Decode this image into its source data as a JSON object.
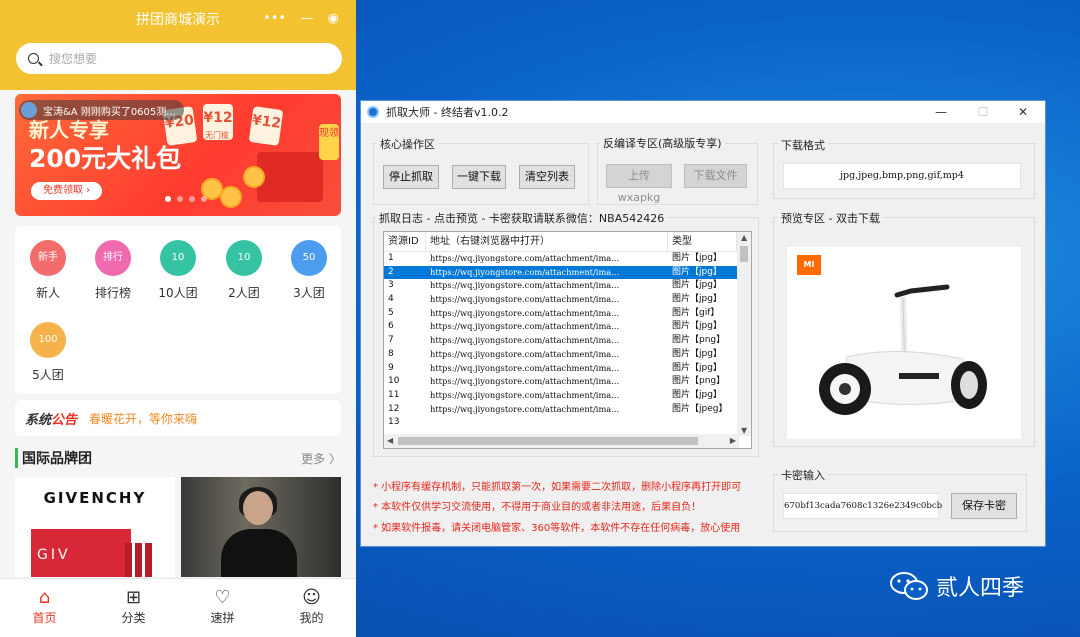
{
  "phone": {
    "title": "拼团商城演示",
    "capsule": [
      "•••",
      "—",
      "◉"
    ],
    "search_placeholder": "搜您想要",
    "banner": {
      "ticker": "宝涛&A 刚刚购买了0605测...",
      "headline1": "新人专享",
      "headline2": "200元大礼包",
      "cta": "免费领取 ›",
      "coupons": [
        "¥20",
        "¥12",
        "¥12"
      ],
      "coupon_sub": "无门槛",
      "side_tag": "现领"
    },
    "categories": [
      {
        "label": "新人",
        "icon_text": "新手",
        "color": "#f36c6c"
      },
      {
        "label": "排行榜",
        "icon_text": "排行",
        "color": "#f06ab0"
      },
      {
        "label": "10人团",
        "icon_text": "10",
        "color": "#36c3a3"
      },
      {
        "label": "2人团",
        "icon_text": "10",
        "color": "#36c3a3"
      },
      {
        "label": "3人团",
        "icon_text": "50",
        "color": "#4c9cf0"
      },
      {
        "label": "5人团",
        "icon_text": "100",
        "color": "#f5b14a"
      }
    ],
    "notice": {
      "prefix": "系统",
      "highlight": "公告",
      "text": "春暖花开，等你来嗨"
    },
    "brands": {
      "title": "国际品牌团",
      "more": "更多 〉",
      "brand1_logo": "GIVENCHY",
      "brand1_box": "GIV"
    },
    "tabs": [
      {
        "label": "首页",
        "icon": "home-icon",
        "glyph": "⌂",
        "active": true
      },
      {
        "label": "分类",
        "icon": "grid-icon",
        "glyph": "⊞",
        "active": false
      },
      {
        "label": "速拼",
        "icon": "heart-icon",
        "glyph": "♡",
        "active": false
      },
      {
        "label": "我的",
        "icon": "smile-icon",
        "glyph": "☺",
        "active": false
      }
    ]
  },
  "app": {
    "title": "抓取大师 - 终结者v1.0.2",
    "window_buttons": [
      "—",
      "☐",
      "✕"
    ],
    "core": {
      "label": "核心操作区",
      "buttons": [
        "停止抓取",
        "一键下载",
        "清空列表"
      ]
    },
    "decompile": {
      "label": "反编译专区(高级版专享)",
      "buttons": [
        "上传wxapkg",
        "下载文件"
      ]
    },
    "format": {
      "label": "下载格式",
      "value": "jpg,jpeg,bmp,png,gif,mp4"
    },
    "log": {
      "label": "抓取日志 - 点击预览 - 卡密获取请联系微信：NBA542426",
      "columns": [
        "资源ID",
        "地址（右键浏览器中打开）",
        "类型"
      ],
      "rows": [
        {
          "id": "1",
          "url": "https://wq.jiyongstore.com/attachment/ima...",
          "type": "图片【jpg】"
        },
        {
          "id": "2",
          "url": "https://wq.jiyongstore.com/attachment/ima...",
          "type": "图片【jpg】"
        },
        {
          "id": "3",
          "url": "https://wq.jiyongstore.com/attachment/ima...",
          "type": "图片【jpg】"
        },
        {
          "id": "4",
          "url": "https://wq.jiyongstore.com/attachment/ima...",
          "type": "图片【jpg】"
        },
        {
          "id": "5",
          "url": "https://wq.jiyongstore.com/attachment/ima...",
          "type": "图片【gif】"
        },
        {
          "id": "6",
          "url": "https://wq.jiyongstore.com/attachment/ima...",
          "type": "图片【jpg】"
        },
        {
          "id": "7",
          "url": "https://wq.jiyongstore.com/attachment/ima...",
          "type": "图片【png】"
        },
        {
          "id": "8",
          "url": "https://wq.jiyongstore.com/attachment/ima...",
          "type": "图片【jpg】"
        },
        {
          "id": "9",
          "url": "https://wq.jiyongstore.com/attachment/ima...",
          "type": "图片【jpg】"
        },
        {
          "id": "10",
          "url": "https://wq.jiyongstore.com/attachment/ima...",
          "type": "图片【png】"
        },
        {
          "id": "11",
          "url": "https://wq.jiyongstore.com/attachment/ima...",
          "type": "图片【jpg】"
        },
        {
          "id": "12",
          "url": "https://wq.jiyongstore.com/attachment/ima...",
          "type": "图片【jpeg】"
        },
        {
          "id": "13",
          "url": "",
          "type": ""
        }
      ],
      "selected_index": 1
    },
    "preview": {
      "label": "预览专区 - 双击下载",
      "brand_badge": "MI"
    },
    "card": {
      "label": "卡密输入",
      "value": "670bf13cada7608c1326e2349c0bcb",
      "button": "保存卡密"
    },
    "tips": [
      "* 小程序有缓存机制，只能抓取第一次，如果需要二次抓取，删除小程序再打开即可",
      "* 本软件仅供学习交流使用，不得用于商业目的或者非法用途，后果自负！",
      "* 如果软件报毒，请关闭电脑管家、360等软件，本软件不存在任何病毒，放心使用"
    ]
  },
  "watermark": {
    "text": "贰人四季",
    "icon": "wechat-icon"
  },
  "colors": {
    "accent_yellow": "#f2c230",
    "accent_red": "#e93323",
    "select_blue": "#0078d7",
    "tip_red": "#e3261b"
  }
}
